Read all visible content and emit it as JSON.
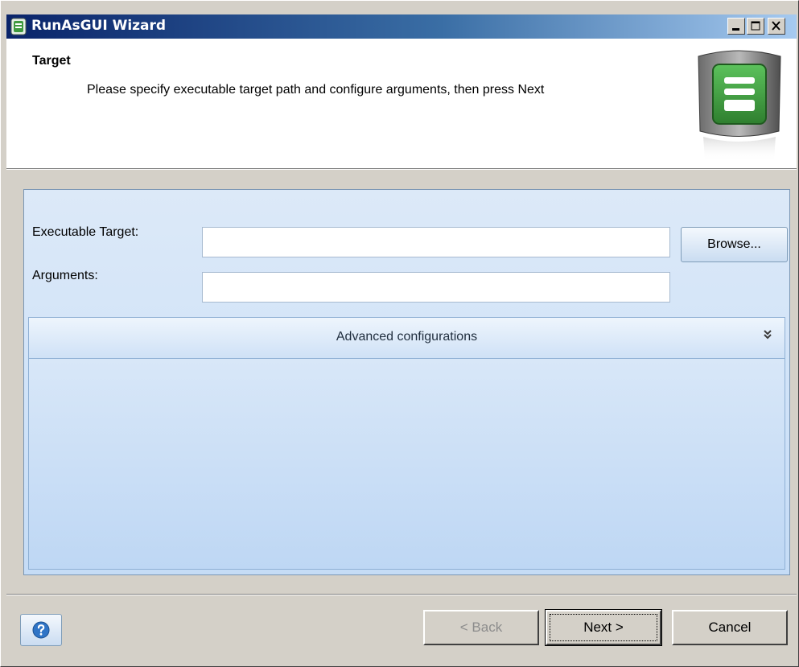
{
  "window": {
    "title": "RunAsGUI Wizard",
    "icon": "runasgui-app-icon"
  },
  "header": {
    "title": "Target",
    "description": "Please specify executable target path and configure arguments, then press Next",
    "logo": "runasgui-logo-icon"
  },
  "form": {
    "executable_label": "Executable Target:",
    "executable_value": "",
    "arguments_label": "Arguments:",
    "arguments_value": "",
    "browse_label": "Browse..."
  },
  "advanced": {
    "label": "Advanced configurations",
    "expand_icon": "double-chevron-down-icon"
  },
  "footer": {
    "help_icon": "question-icon",
    "back_label": "< Back",
    "next_label": "Next >",
    "cancel_label": "Cancel"
  },
  "colors": {
    "titlebar_start": "#0a246a",
    "titlebar_end": "#a6caf0",
    "panel_bg": "#cfe2f8",
    "logo_green": "#3f9a3f"
  }
}
